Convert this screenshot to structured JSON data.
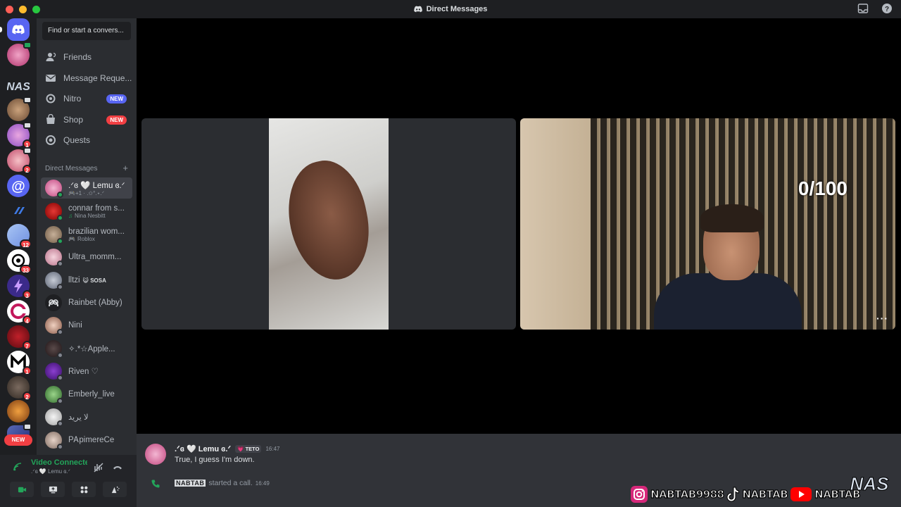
{
  "window": {
    "title": "Direct Messages"
  },
  "search": {
    "placeholder": "Find or start a convers..."
  },
  "nav": {
    "friends": "Friends",
    "message_requests": "Message Reque...",
    "nitro": "Nitro",
    "nitro_tag": "NEW",
    "shop": "Shop",
    "shop_tag": "NEW",
    "quests": "Quests"
  },
  "dm_section": {
    "header": "Direct Messages",
    "add": "+"
  },
  "dms": [
    {
      "name": ".ᐟɞ 🤍 Lemu ɞ.ᐟ",
      "sub": "🎮+1 · .✩°.⋆.ᐟ",
      "active": true
    },
    {
      "name": "connar from s...",
      "sub": "Nina Nesbitt",
      "sub_icon": "♫"
    },
    {
      "name": "brazilian wom...",
      "sub": "Roblox",
      "sub_icon": "🎮"
    },
    {
      "name": "Ultra_momm...",
      "sub": ""
    },
    {
      "name": "lltzi",
      "tag": "😺 SOSA"
    },
    {
      "name": "Rainbet (Abby)",
      "sub": ""
    },
    {
      "name": "Nini",
      "sub": ""
    },
    {
      "name": "✧.*☆Apple...",
      "sub": ""
    },
    {
      "name": "Riven ♡",
      "sub": ""
    },
    {
      "name": "Emberly_live",
      "sub": ""
    },
    {
      "name": "لا يريد",
      "sub": ""
    },
    {
      "name": "PᎪpimereCe",
      "sub": ""
    }
  ],
  "rail": {
    "new_label": "NEW",
    "badges": [
      "1",
      "2",
      "12",
      "33",
      "3",
      "4",
      "7",
      "1",
      "2"
    ]
  },
  "voice": {
    "title": "Video Connected",
    "subtitle": ".ᐟɞ 🤍 Lemu ɞ.ᐟ"
  },
  "call": {
    "overlay_counter": "0/100",
    "more": "···"
  },
  "chat": {
    "author": ".ᐟɞ 🤍 Lemu ɞ.ᐟ",
    "author_tag": "💗 TETO",
    "time": "16:47",
    "text": "True, I guess I'm down.",
    "system_name": "NABTAB",
    "system_text": "started a call.",
    "system_time": "16:49"
  },
  "watermark": {
    "instagram": "NABTAB9988",
    "tiktok": "NABTAB",
    "youtube": "NABTAB",
    "logo": "NAS"
  },
  "colors": {
    "blurple": "#5865f2",
    "green": "#23a55a",
    "red": "#f23f43"
  }
}
